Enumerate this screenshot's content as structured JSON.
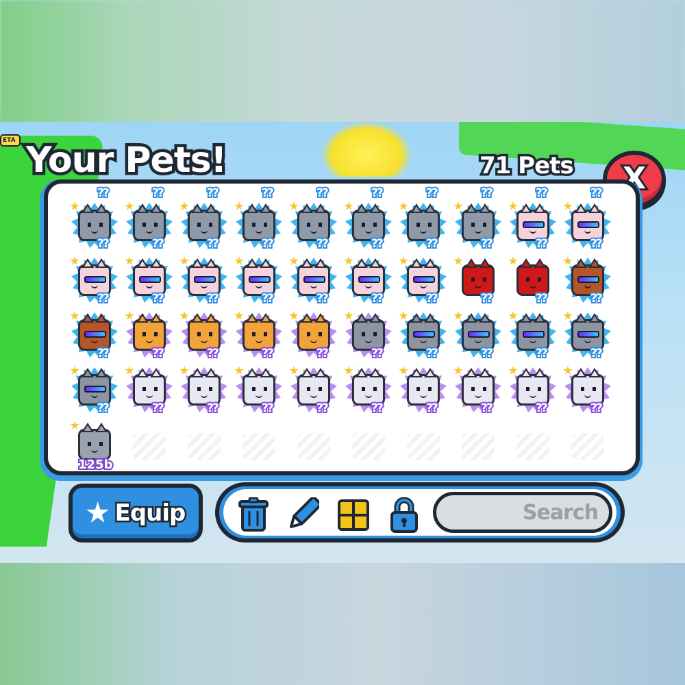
{
  "header": {
    "title": "Your Pets!",
    "pet_count": "71 Pets",
    "close_label": "X",
    "beta_badge": "ETA"
  },
  "top_row_cells": [
    {
      "label": "??"
    },
    {
      "label": "??"
    },
    {
      "label": "??"
    },
    {
      "label": "??"
    },
    {
      "label": "??"
    },
    {
      "label": "??"
    },
    {
      "label": "??"
    },
    {
      "label": "??"
    },
    {
      "label": "??"
    },
    {
      "label": "??"
    }
  ],
  "pets": [
    {
      "kind": "cat-gray-hat",
      "bg": "blue",
      "color": "#8f9aa8",
      "label": "??"
    },
    {
      "kind": "cat-gray-hat",
      "bg": "blue",
      "color": "#8f9aa8",
      "label": "??"
    },
    {
      "kind": "cat-gray-hat",
      "bg": "blue",
      "color": "#8f9aa8",
      "label": "??"
    },
    {
      "kind": "cat-gray-hat",
      "bg": "blue",
      "color": "#8f9aa8",
      "label": "??"
    },
    {
      "kind": "cat-gray-hat",
      "bg": "blue",
      "color": "#8f9aa8",
      "label": "??"
    },
    {
      "kind": "cat-gray-hat",
      "bg": "blue",
      "color": "#8f9aa8",
      "label": "??"
    },
    {
      "kind": "cat-gray-hat",
      "bg": "blue",
      "color": "#8f9aa8",
      "label": "??"
    },
    {
      "kind": "cat-gray-hat",
      "bg": "blue",
      "color": "#8f9aa8",
      "label": "??"
    },
    {
      "kind": "pink-shades",
      "bg": "blue",
      "color": "#f4d3dc",
      "label": "??"
    },
    {
      "kind": "pink-shades",
      "bg": "blue",
      "color": "#f4d3dc",
      "label": "??"
    },
    {
      "kind": "pink-shades",
      "bg": "blue",
      "color": "#f4d3dc",
      "label": "??"
    },
    {
      "kind": "pink-shades",
      "bg": "blue",
      "color": "#f4d3dc",
      "label": "??"
    },
    {
      "kind": "pink-shades",
      "bg": "blue",
      "color": "#f4d3dc",
      "label": "??"
    },
    {
      "kind": "pink-shades",
      "bg": "blue",
      "color": "#f4d3dc",
      "label": "??"
    },
    {
      "kind": "pink-shades",
      "bg": "blue",
      "color": "#f4d3dc",
      "label": "??"
    },
    {
      "kind": "pink-shades",
      "bg": "blue",
      "color": "#f4d3dc",
      "label": "??"
    },
    {
      "kind": "pink-shades",
      "bg": "blue",
      "color": "#f4d3dc",
      "label": "??"
    },
    {
      "kind": "red-demon",
      "bg": "none",
      "color": "#d01818",
      "label": "??"
    },
    {
      "kind": "red-demon",
      "bg": "none",
      "color": "#d01818",
      "label": "??"
    },
    {
      "kind": "brown-shades",
      "bg": "blue",
      "color": "#b5552a",
      "label": "??"
    },
    {
      "kind": "brown-shades",
      "bg": "blue",
      "color": "#b5552a",
      "label": "??"
    },
    {
      "kind": "orange-corgi",
      "bg": "purple",
      "color": "#f2a43a",
      "label": "??"
    },
    {
      "kind": "orange-corgi",
      "bg": "purple",
      "color": "#f2a43a",
      "label": "??"
    },
    {
      "kind": "orange-corgi",
      "bg": "purple",
      "color": "#f2a43a",
      "label": "??"
    },
    {
      "kind": "orange-corgi",
      "bg": "purple",
      "color": "#f2a43a",
      "label": "??"
    },
    {
      "kind": "gray-cat",
      "bg": "purple",
      "color": "#8d95a3",
      "label": "??"
    },
    {
      "kind": "gray-shades",
      "bg": "blue",
      "color": "#8d95a3",
      "label": "??"
    },
    {
      "kind": "gray-shades",
      "bg": "blue",
      "color": "#8d95a3",
      "label": "??"
    },
    {
      "kind": "gray-shades",
      "bg": "blue",
      "color": "#8d95a3",
      "label": "??"
    },
    {
      "kind": "gray-shades",
      "bg": "blue",
      "color": "#8d95a3",
      "label": "??"
    },
    {
      "kind": "gray-shades",
      "bg": "blue",
      "color": "#8d95a3",
      "label": "??"
    },
    {
      "kind": "ghost",
      "bg": "purple",
      "color": "#e8e8f2",
      "label": "??"
    },
    {
      "kind": "ghost",
      "bg": "purple",
      "color": "#e8e8f2",
      "label": "??"
    },
    {
      "kind": "ghost",
      "bg": "purple",
      "color": "#e8e8f2",
      "label": "??"
    },
    {
      "kind": "ghost",
      "bg": "purple",
      "color": "#e8e8f2",
      "label": "??"
    },
    {
      "kind": "ghost",
      "bg": "purple",
      "color": "#e8e8f2",
      "label": "??"
    },
    {
      "kind": "ghost",
      "bg": "purple",
      "color": "#e8e8f2",
      "label": "??"
    },
    {
      "kind": "ghost",
      "bg": "purple",
      "color": "#e8e8f2",
      "label": "??"
    },
    {
      "kind": "ghost",
      "bg": "purple",
      "color": "#e8e8f2",
      "label": "??"
    },
    {
      "kind": "ghost",
      "bg": "purple",
      "color": "#e8e8f2",
      "label": "??"
    },
    {
      "kind": "gray-wolf",
      "bg": "none",
      "color": "#9aa2b0",
      "label": "125b"
    }
  ],
  "empty_slots": 9,
  "footer": {
    "equip_label": "Equip",
    "tools": [
      "trash-icon",
      "pencil-icon",
      "grid-icon",
      "lock-icon"
    ],
    "search_placeholder": "Search"
  },
  "colors": {
    "accent_blue": "#2f8fe0",
    "close_red": "#ef3e49",
    "outline": "#1e2733"
  }
}
